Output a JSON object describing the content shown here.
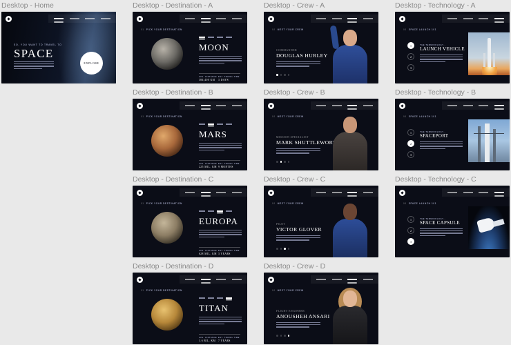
{
  "frames": {
    "home": {
      "label": "Desktop - Home",
      "eyebrow": "SO, YOU WANT TO TRAVEL TO",
      "title": "SPACE",
      "explore_label": "EXPLORE"
    },
    "destination_a": {
      "label": "Desktop - Destination - A",
      "eyebrow_num": "01",
      "eyebrow": "PICK YOUR DESTINATION",
      "title": "MOON",
      "stat1_label": "AVG. DISTANCE",
      "stat1_value": "384,400 KM",
      "stat2_label": "EST. TRAVEL TIME",
      "stat2_value": "3 DAYS"
    },
    "destination_b": {
      "label": "Desktop - Destination - B",
      "eyebrow_num": "01",
      "eyebrow": "PICK YOUR DESTINATION",
      "title": "MARS",
      "stat1_label": "AVG. DISTANCE",
      "stat1_value": "225 MIL. KM",
      "stat2_label": "EST. TRAVEL TIME",
      "stat2_value": "9 MONTHS"
    },
    "destination_c": {
      "label": "Desktop - Destination - C",
      "eyebrow_num": "01",
      "eyebrow": "PICK YOUR DESTINATION",
      "title": "EUROPA",
      "stat1_label": "AVG. DISTANCE",
      "stat1_value": "628 MIL. KM",
      "stat2_label": "EST. TRAVEL TIME",
      "stat2_value": "3 YEARS"
    },
    "destination_d": {
      "label": "Desktop - Destination - D",
      "eyebrow_num": "01",
      "eyebrow": "PICK YOUR DESTINATION",
      "title": "TITAN",
      "stat1_label": "AVG. DISTANCE",
      "stat1_value": "1.6 BIL. KM",
      "stat2_label": "EST. TRAVEL TIME",
      "stat2_value": "7 YEARS"
    },
    "crew_a": {
      "label": "Desktop - Crew - A",
      "eyebrow_num": "02",
      "eyebrow": "MEET YOUR CREW",
      "role": "COMMANDER",
      "name": "DOUGLAS HURLEY"
    },
    "crew_b": {
      "label": "Desktop - Crew - B",
      "eyebrow_num": "02",
      "eyebrow": "MEET YOUR CREW",
      "role": "MISSION SPECIALIST",
      "name": "MARK SHUTTLEWORTH"
    },
    "crew_c": {
      "label": "Desktop - Crew - C",
      "eyebrow_num": "02",
      "eyebrow": "MEET YOUR CREW",
      "role": "PILOT",
      "name": "VICTOR GLOVER"
    },
    "crew_d": {
      "label": "Desktop - Crew - D",
      "eyebrow_num": "02",
      "eyebrow": "MEET YOUR CREW",
      "role": "FLIGHT ENGINEER",
      "name": "ANOUSHEH ANSARI"
    },
    "technology_a": {
      "label": "Desktop - Technology - A",
      "eyebrow_num": "03",
      "eyebrow": "SPACE LAUNCH 101",
      "term": "THE TERMINOLOGY...",
      "title": "LAUNCH VEHICLE",
      "nums": [
        "1",
        "2",
        "3"
      ],
      "active": 0
    },
    "technology_b": {
      "label": "Desktop - Technology - B",
      "eyebrow_num": "03",
      "eyebrow": "SPACE LAUNCH 101",
      "term": "THE TERMINOLOGY...",
      "title": "SPACEPORT",
      "nums": [
        "1",
        "2",
        "3"
      ],
      "active": 1
    },
    "technology_c": {
      "label": "Desktop - Technology - C",
      "eyebrow_num": "03",
      "eyebrow": "SPACE LAUNCH 101",
      "term": "THE TERMINOLOGY...",
      "title": "SPACE CAPSULE",
      "nums": [
        "1",
        "2",
        "3"
      ],
      "active": 2
    }
  },
  "colors": {
    "page_bg": "#e9e9e9",
    "frame_bg": "#0b0d17",
    "accent": "#d0d6f9",
    "white": "#ffffff"
  }
}
